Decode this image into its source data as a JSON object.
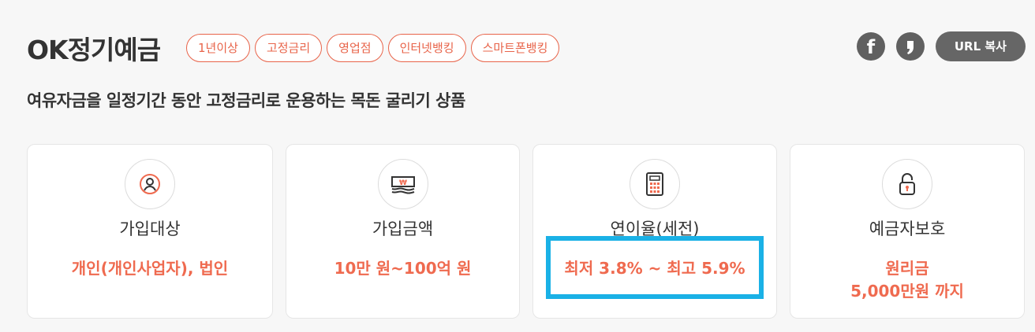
{
  "product": {
    "title": "OK정기예금",
    "subtitle": "여유자금을 일정기간 동안 고정금리로 운용하는 목돈 굴리기 상품"
  },
  "tags": [
    "1년이상",
    "고정금리",
    "영업점",
    "인터넷뱅킹",
    "스마트폰뱅킹"
  ],
  "share": {
    "facebook_icon": "f",
    "kakao_icon": ",",
    "url_copy_label": "URL 복사"
  },
  "cards": [
    {
      "icon": "person-icon",
      "label": "가입대상",
      "value_lines": [
        "개인(개인사업자), 법인"
      ]
    },
    {
      "icon": "money-icon",
      "label": "가입금액",
      "value_lines": [
        "10만 원~100억 원"
      ]
    },
    {
      "icon": "calculator-icon",
      "label": "연이율(세전)",
      "value_lines": [
        "최저 3.8% ~ 최고 5.9%"
      ]
    },
    {
      "icon": "lock-icon",
      "label": "예금자보호",
      "value_lines": [
        "원리금",
        "5,000만원 까지"
      ]
    }
  ],
  "colors": {
    "accent": "#ef6a4f",
    "tag_border": "#e8644a",
    "highlight": "#1ab1e6",
    "button_gray": "#666666"
  }
}
